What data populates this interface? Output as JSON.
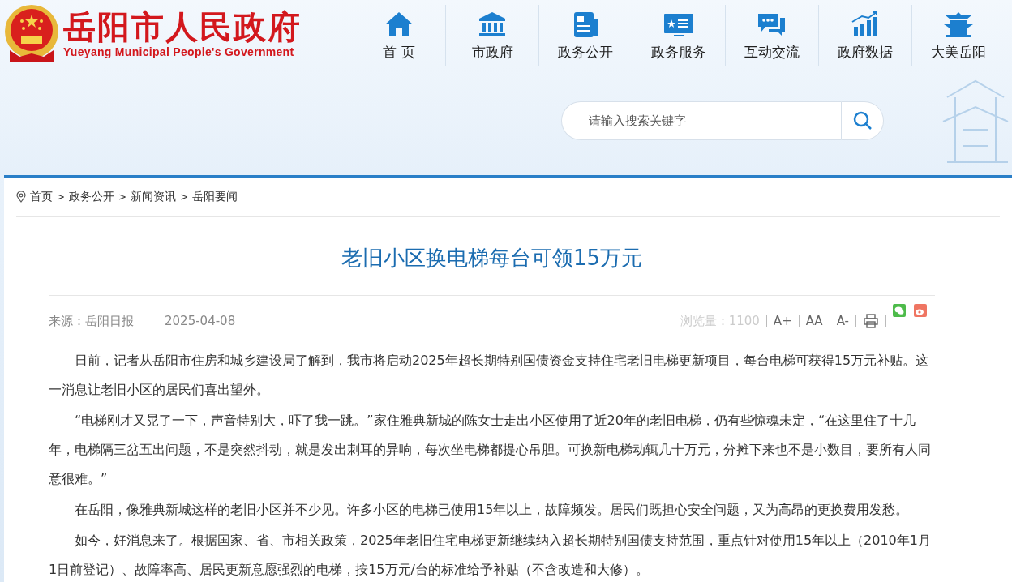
{
  "header": {
    "site_title": "岳阳市人民政府",
    "site_subtitle": "Yueyang Municipal People's Government",
    "nav": [
      {
        "label": "首 页",
        "kind": "home"
      },
      {
        "label": "市政府",
        "kind": "building"
      },
      {
        "label": "政务公开",
        "kind": "newspaper"
      },
      {
        "label": "政务服务",
        "kind": "card"
      },
      {
        "label": "互动交流",
        "kind": "chat"
      },
      {
        "label": "政府数据",
        "kind": "chart"
      },
      {
        "label": "大美岳阳",
        "kind": "tower"
      }
    ],
    "search": {
      "placeholder": "请输入搜索关键字"
    }
  },
  "breadcrumb": [
    "首页",
    "政务公开",
    "新闻资讯",
    "岳阳要闻"
  ],
  "breadcrumb_separator": ">",
  "article": {
    "title": "老旧小区换电梯每台可领15万元",
    "source": "来源：岳阳日报",
    "date": "2025-04-08",
    "views": "浏览量：1100",
    "font_controls": [
      "A+",
      "AA",
      "A-"
    ],
    "paragraphs": [
      "日前，记者从岳阳市住房和城乡建设局了解到，我市将启动2025年超长期特别国债资金支持住宅老旧电梯更新项目，每台电梯可获得15万元补贴。这一消息让老旧小区的居民们喜出望外。",
      "“电梯刚才又晃了一下，声音特别大，吓了我一跳。”家住雅典新城的陈女士走出小区使用了近20年的老旧电梯，仍有些惊魂未定，“在这里住了十几年，电梯隔三岔五出问题，不是突然抖动，就是发出刺耳的异响，每次坐电梯都提心吊胆。可换新电梯动辄几十万元，分摊下来也不是小数目，要所有人同意很难。”",
      "在岳阳，像雅典新城这样的老旧小区并不少见。许多小区的电梯已使用15年以上，故障频发。居民们既担心安全问题，又为高昂的更换费用发愁。",
      "如今，好消息来了。根据国家、省、市相关政策，2025年老旧住宅电梯更新继续纳入超长期特别国债支持范围，重点针对使用15年以上（2010年1月1日前登记）、故障率高、居民更新意愿强烈的电梯，按15万元/台的标准给予补贴（不含改造和大修）。"
    ]
  }
}
